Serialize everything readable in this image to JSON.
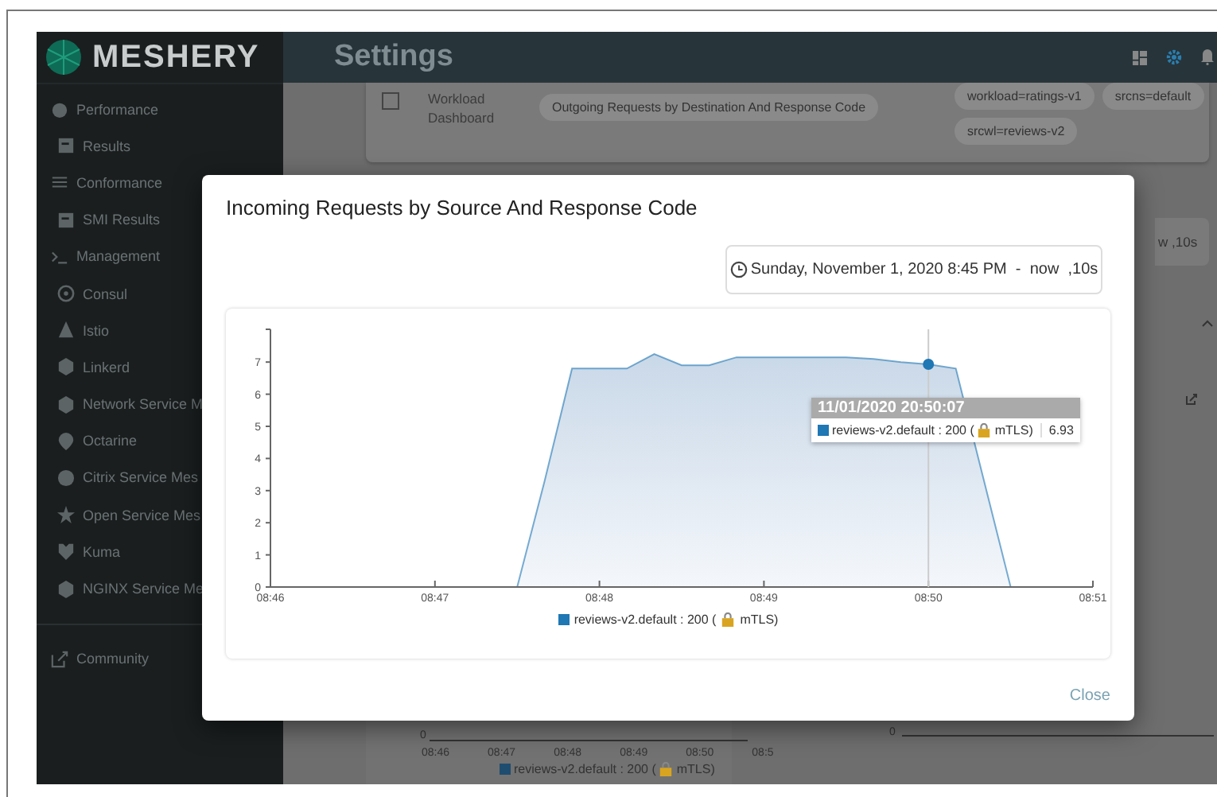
{
  "sidebar": {
    "brand": "MESHERY",
    "items": [
      {
        "label": "Performance",
        "sub": false
      },
      {
        "label": "Results",
        "sub": true
      },
      {
        "label": "Conformance",
        "sub": false
      },
      {
        "label": "SMI Results",
        "sub": true
      },
      {
        "label": "Management",
        "sub": false
      },
      {
        "label": "Consul",
        "sub": true
      },
      {
        "label": "Istio",
        "sub": true
      },
      {
        "label": "Linkerd",
        "sub": true
      },
      {
        "label": "Network Service M",
        "sub": true
      },
      {
        "label": "Octarine",
        "sub": true
      },
      {
        "label": "Citrix Service Mes",
        "sub": true
      },
      {
        "label": "Open Service Mes",
        "sub": true
      },
      {
        "label": "Kuma",
        "sub": true
      },
      {
        "label": "NGINX Service Me",
        "sub": true
      }
    ],
    "footer": "Community"
  },
  "header": {
    "title": "Settings"
  },
  "background": {
    "workload": {
      "checked": false,
      "label": "Workload Dashboard"
    },
    "chips": [
      "Outgoing Requests by Destination And Response Code"
    ],
    "filters": [
      "workload=ratings-v1",
      "srcns=default",
      "srcwl=reviews-v2"
    ],
    "range_fragment": "w ,10s",
    "bottom_chart": {
      "y_tick": "0",
      "x_ticks": [
        "08:46",
        "08:47",
        "08:48",
        "08:49",
        "08:50",
        "08:5"
      ],
      "legend_before": "reviews-v2.default : 200 (",
      "legend_after": "mTLS)"
    },
    "second_chart": {
      "y_tick": "0"
    }
  },
  "dialog": {
    "title": "Incoming Requests by Source And Response Code",
    "range": "Sunday, November 1, 2020 8:45 PM  -  now  ,10s",
    "chart_data": {
      "type": "area",
      "categories": [
        "08:46",
        null,
        null,
        null,
        null,
        null,
        "08:47",
        null,
        null,
        null,
        null,
        null,
        "08:48",
        null,
        null,
        null,
        null,
        null,
        "08:49",
        null,
        null,
        null,
        null,
        null,
        "08:50",
        null,
        null,
        null,
        null,
        null,
        "08:51"
      ],
      "series": [
        {
          "color": "#1f77b4",
          "values": [
            null,
            null,
            null,
            null,
            null,
            null,
            null,
            null,
            null,
            0,
            3.3,
            6.8,
            6.8,
            6.8,
            7.25,
            6.9,
            6.9,
            7.15,
            7.15,
            7.15,
            7.15,
            7.15,
            7.1,
            7.0,
            6.93,
            6.8,
            3.4,
            0,
            null,
            null,
            null
          ]
        }
      ],
      "ylim": [
        0,
        8
      ],
      "yticks": [
        0,
        1,
        2,
        3,
        4,
        5,
        6,
        7
      ]
    },
    "legend_before": "reviews-v2.default : 200 (",
    "legend_after": "mTLS)",
    "tooltip": {
      "time": "11/01/2020 20:50:07",
      "label_before": "reviews-v2.default : 200 (",
      "label_after": "mTLS)",
      "value": "6.93"
    },
    "close": "Close"
  }
}
